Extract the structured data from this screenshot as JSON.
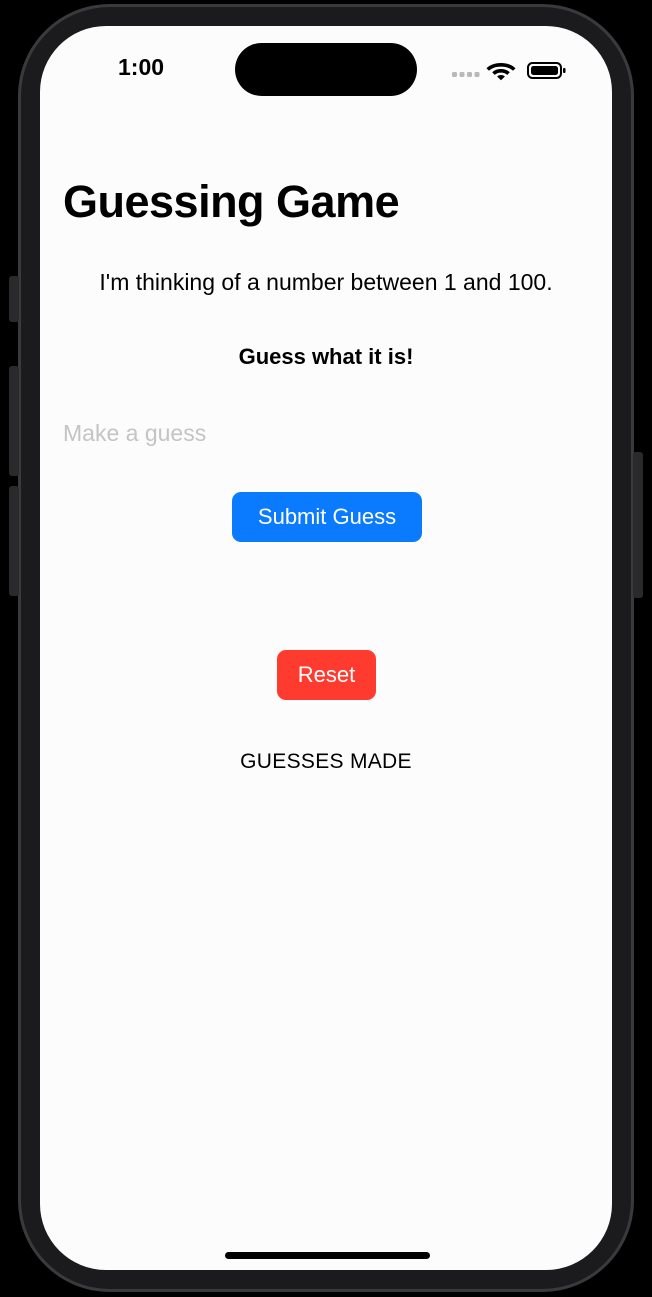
{
  "status_bar": {
    "time": "1:00",
    "icons": [
      "cellular-signal-icon",
      "wifi-icon",
      "battery-icon"
    ]
  },
  "game": {
    "title": "Guessing Game",
    "intro": "I'm thinking of a number between 1 and 100.",
    "prompt": "Guess what it is!",
    "guess_input": {
      "value": "",
      "placeholder": "Make a guess"
    },
    "submit_label": "Submit Guess",
    "reset_label": "Reset",
    "guesses_header": "GUESSES MADE"
  },
  "colors": {
    "submit_button": "#0a7aff",
    "reset_button": "#ff3b30",
    "background": "#fcfcfc",
    "placeholder": "#c4c4c7"
  }
}
